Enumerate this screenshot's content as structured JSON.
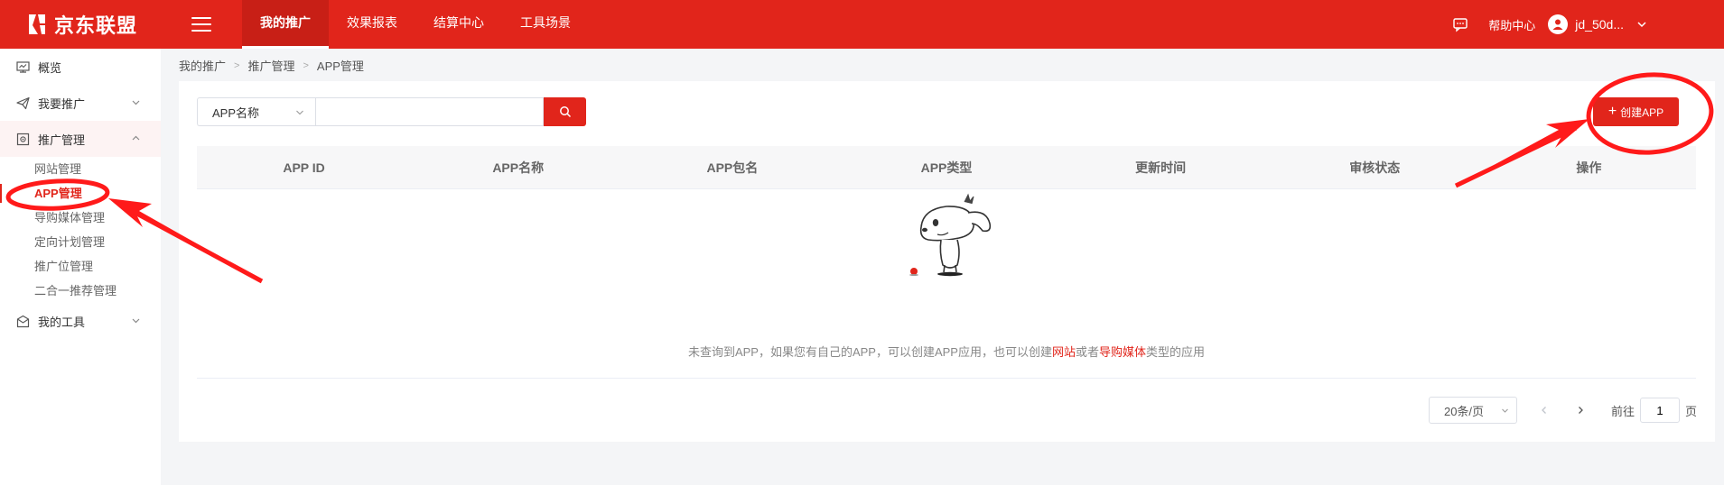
{
  "header": {
    "logo_text": "京东联盟",
    "nav": [
      {
        "label": "我的推广",
        "active": true
      },
      {
        "label": "效果报表",
        "active": false
      },
      {
        "label": "结算中心",
        "active": false
      },
      {
        "label": "工具场景",
        "active": false
      }
    ],
    "help_label": "帮助中心",
    "username": "jd_50d...",
    "icons": [
      "menu-icon",
      "message-icon",
      "user-icon",
      "chevron-down-icon"
    ]
  },
  "sidebar": {
    "overview": "概览",
    "promote": "我要推广",
    "manage": "推广管理",
    "sub_items": [
      "网站管理",
      "APP管理",
      "导购媒体管理",
      "定向计划管理",
      "推广位管理",
      "二合一推荐管理"
    ],
    "active_sub": "APP管理",
    "tools": "我的工具"
  },
  "breadcrumb": [
    "我的推广",
    "推广管理",
    "APP管理"
  ],
  "search": {
    "field_label": "APP名称",
    "value": "",
    "placeholder": ""
  },
  "create_button": "创建APP",
  "table": {
    "columns": [
      "APP ID",
      "APP名称",
      "APP包名",
      "APP类型",
      "更新时间",
      "审核状态",
      "操作"
    ],
    "rows": [],
    "empty_text_a": "未查询到APP，如果您有自己的APP，可以创建APP应用，也可以创建",
    "empty_link_website": "网站",
    "empty_text_b": "或者",
    "empty_link_media": "导购媒体",
    "empty_text_c": "类型的应用"
  },
  "pagination": {
    "page_size": "20条/页",
    "goto_prefix": "前往",
    "current_page": "1",
    "goto_suffix": "页"
  },
  "colors": {
    "brand_red": "#e1251b",
    "annotation_red": "#ff1a1a"
  }
}
